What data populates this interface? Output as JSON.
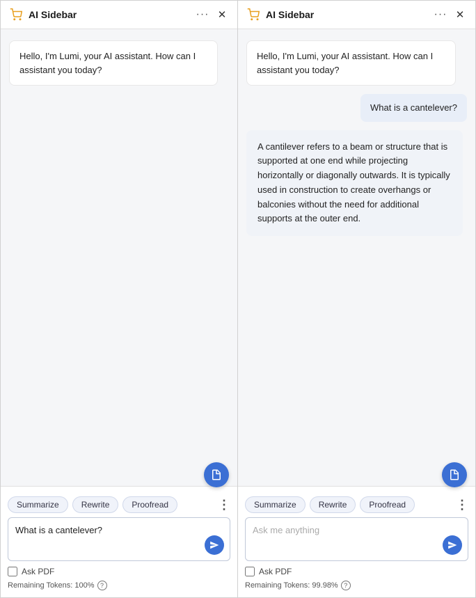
{
  "panels": [
    {
      "id": "left-panel",
      "header": {
        "title": "AI Sidebar",
        "cart_icon": "🛒",
        "more_icon": "···",
        "close_icon": "✕"
      },
      "messages": [
        {
          "type": "ai",
          "text": "Hello, I'm Lumi, your AI assistant. How can I assistant you today?"
        }
      ],
      "fab_label": "doc-icon",
      "chips": [
        {
          "label": "Summarize",
          "id": "summarize"
        },
        {
          "label": "Rewrite",
          "id": "rewrite"
        },
        {
          "label": "Proofread",
          "id": "proofread"
        }
      ],
      "more_chips_icon": "⋮",
      "input_placeholder": "Ask me anything",
      "input_value": "What is a cantelever?",
      "ask_pdf_label": "Ask PDF",
      "tokens_label": "Remaining Tokens: 100%",
      "tokens_help": "?"
    },
    {
      "id": "right-panel",
      "header": {
        "title": "AI Sidebar",
        "cart_icon": "🛒",
        "more_icon": "···",
        "close_icon": "✕"
      },
      "messages": [
        {
          "type": "ai",
          "text": "Hello, I'm Lumi, your AI assistant. How can I assistant you today?"
        },
        {
          "type": "user",
          "text": "What is a cantelever?"
        },
        {
          "type": "ai-answer",
          "text": "A cantilever refers to a beam or structure that is supported at one end while projecting horizontally or diagonally outwards. It is typically used in construction to create overhangs or balconies without the need for additional supports at the outer end."
        }
      ],
      "fab_label": "doc-icon",
      "chips": [
        {
          "label": "Summarize",
          "id": "summarize"
        },
        {
          "label": "Rewrite",
          "id": "rewrite"
        },
        {
          "label": "Proofread",
          "id": "proofread"
        }
      ],
      "more_chips_icon": "⋮",
      "input_placeholder": "Ask me anything",
      "input_value": "",
      "ask_pdf_label": "Ask PDF",
      "tokens_label": "Remaining Tokens: 99.98%",
      "tokens_help": "?"
    }
  ]
}
